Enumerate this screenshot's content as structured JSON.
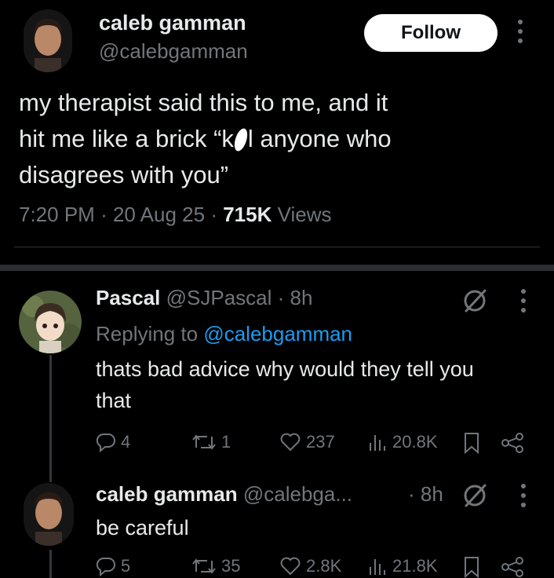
{
  "tweet": {
    "author_name": "caleb gamman",
    "author_handle": "@calebgamman",
    "follow_label": "Follow",
    "text_line1": "my therapist said this to me, and it",
    "text_line2_a": "hit me like a brick “k",
    "text_line2_b": "l anyone who",
    "text_line3": "disagrees with you”",
    "time": "7:20 PM",
    "date": "20 Aug 25",
    "views_count": "715K",
    "views_label": "Views"
  },
  "replies": [
    {
      "name": "Pascal",
      "handle": "@SJPascal",
      "time": "· 8h",
      "replying_prefix": "Replying to",
      "replying_handle": "@calebgamman",
      "text_line1": "thats bad advice why would they tell you",
      "text_line2": "that",
      "replies": "4",
      "retweets": "1",
      "likes": "237",
      "views": "20.8K"
    },
    {
      "name": "caleb gamman",
      "handle": "@calebga...",
      "time": "· 8h",
      "text_line1": "be careful",
      "replies": "5",
      "retweets": "35",
      "likes": "2.8K",
      "views": "21.8K"
    }
  ],
  "colors": {
    "background": "#000000",
    "text": "#e7e9ea",
    "muted": "#71767b",
    "link": "#1d9bf0",
    "divider": "#2f3336"
  },
  "icons": [
    "more-icon",
    "reply-icon",
    "retweet-icon",
    "like-icon",
    "views-icon",
    "bookmark-icon",
    "share-icon",
    "grok-icon"
  ]
}
